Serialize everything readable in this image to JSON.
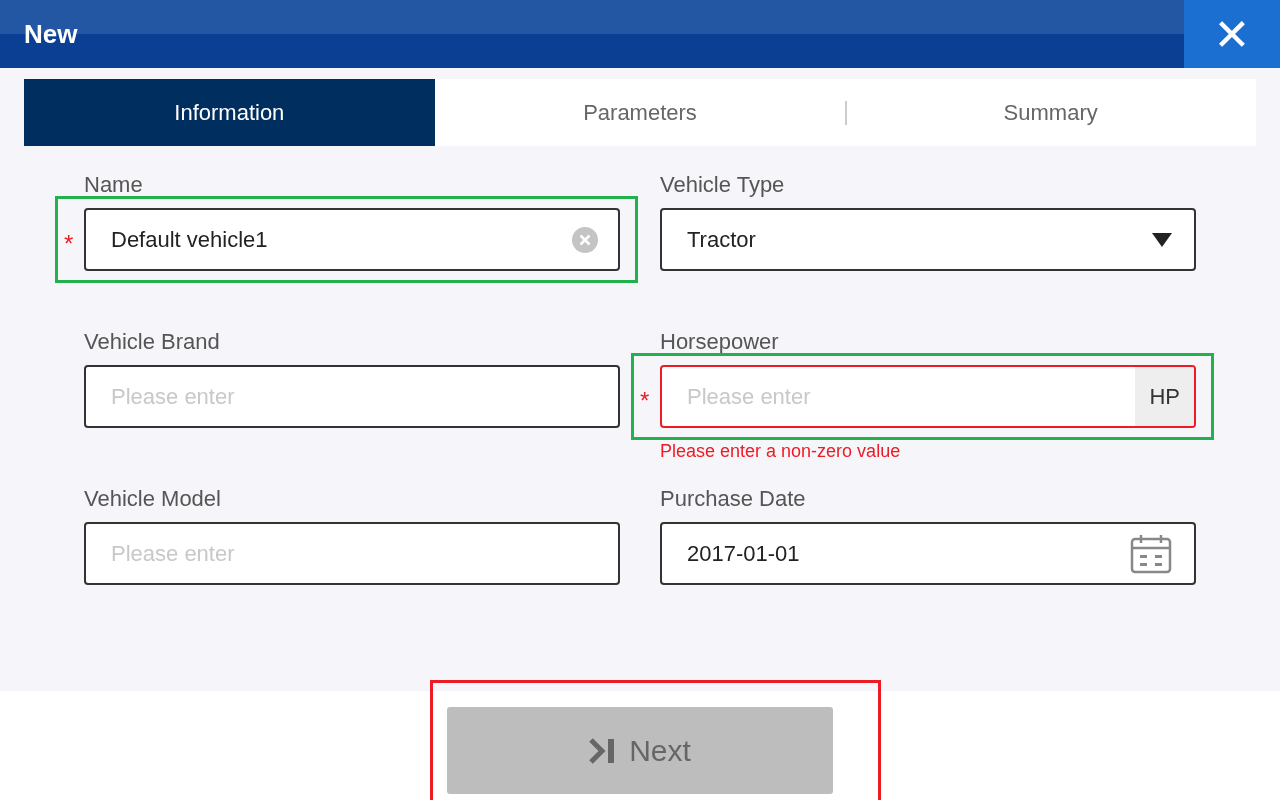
{
  "window": {
    "title": "New",
    "close": "✕"
  },
  "tabs": [
    {
      "label": "Information",
      "selected": true
    },
    {
      "label": "Parameters",
      "selected": false
    },
    {
      "label": "Summary",
      "selected": false
    }
  ],
  "fields": [
    {
      "kind": "text",
      "label": "Name",
      "value": "Default vehicle1",
      "required": true,
      "clearable": true,
      "error": false,
      "highlight": {
        "color": "#22b14c"
      }
    },
    {
      "kind": "select",
      "label": "Vehicle Type",
      "value": "Tractor",
      "required": false,
      "error": false
    },
    {
      "kind": "text",
      "label": "Vehicle Brand",
      "placeholder": "Please enter",
      "required": false,
      "error": false
    },
    {
      "kind": "text",
      "label": "Horsepower",
      "placeholder": "Please enter",
      "unit": "HP",
      "required": true,
      "error": true,
      "error_text": "Please enter a non-zero value",
      "highlight": {
        "color": "#22b14c"
      }
    },
    {
      "kind": "text",
      "label": "Vehicle Model",
      "placeholder": "Please enter",
      "required": false,
      "error": false
    },
    {
      "kind": "date",
      "label": "Purchase Date",
      "value": "2017-01-01",
      "required": false,
      "error": false
    }
  ],
  "required_mark": "*",
  "next_button": {
    "label": "Next",
    "disabled": true,
    "highlight": {
      "color": "#ed1c24"
    }
  }
}
